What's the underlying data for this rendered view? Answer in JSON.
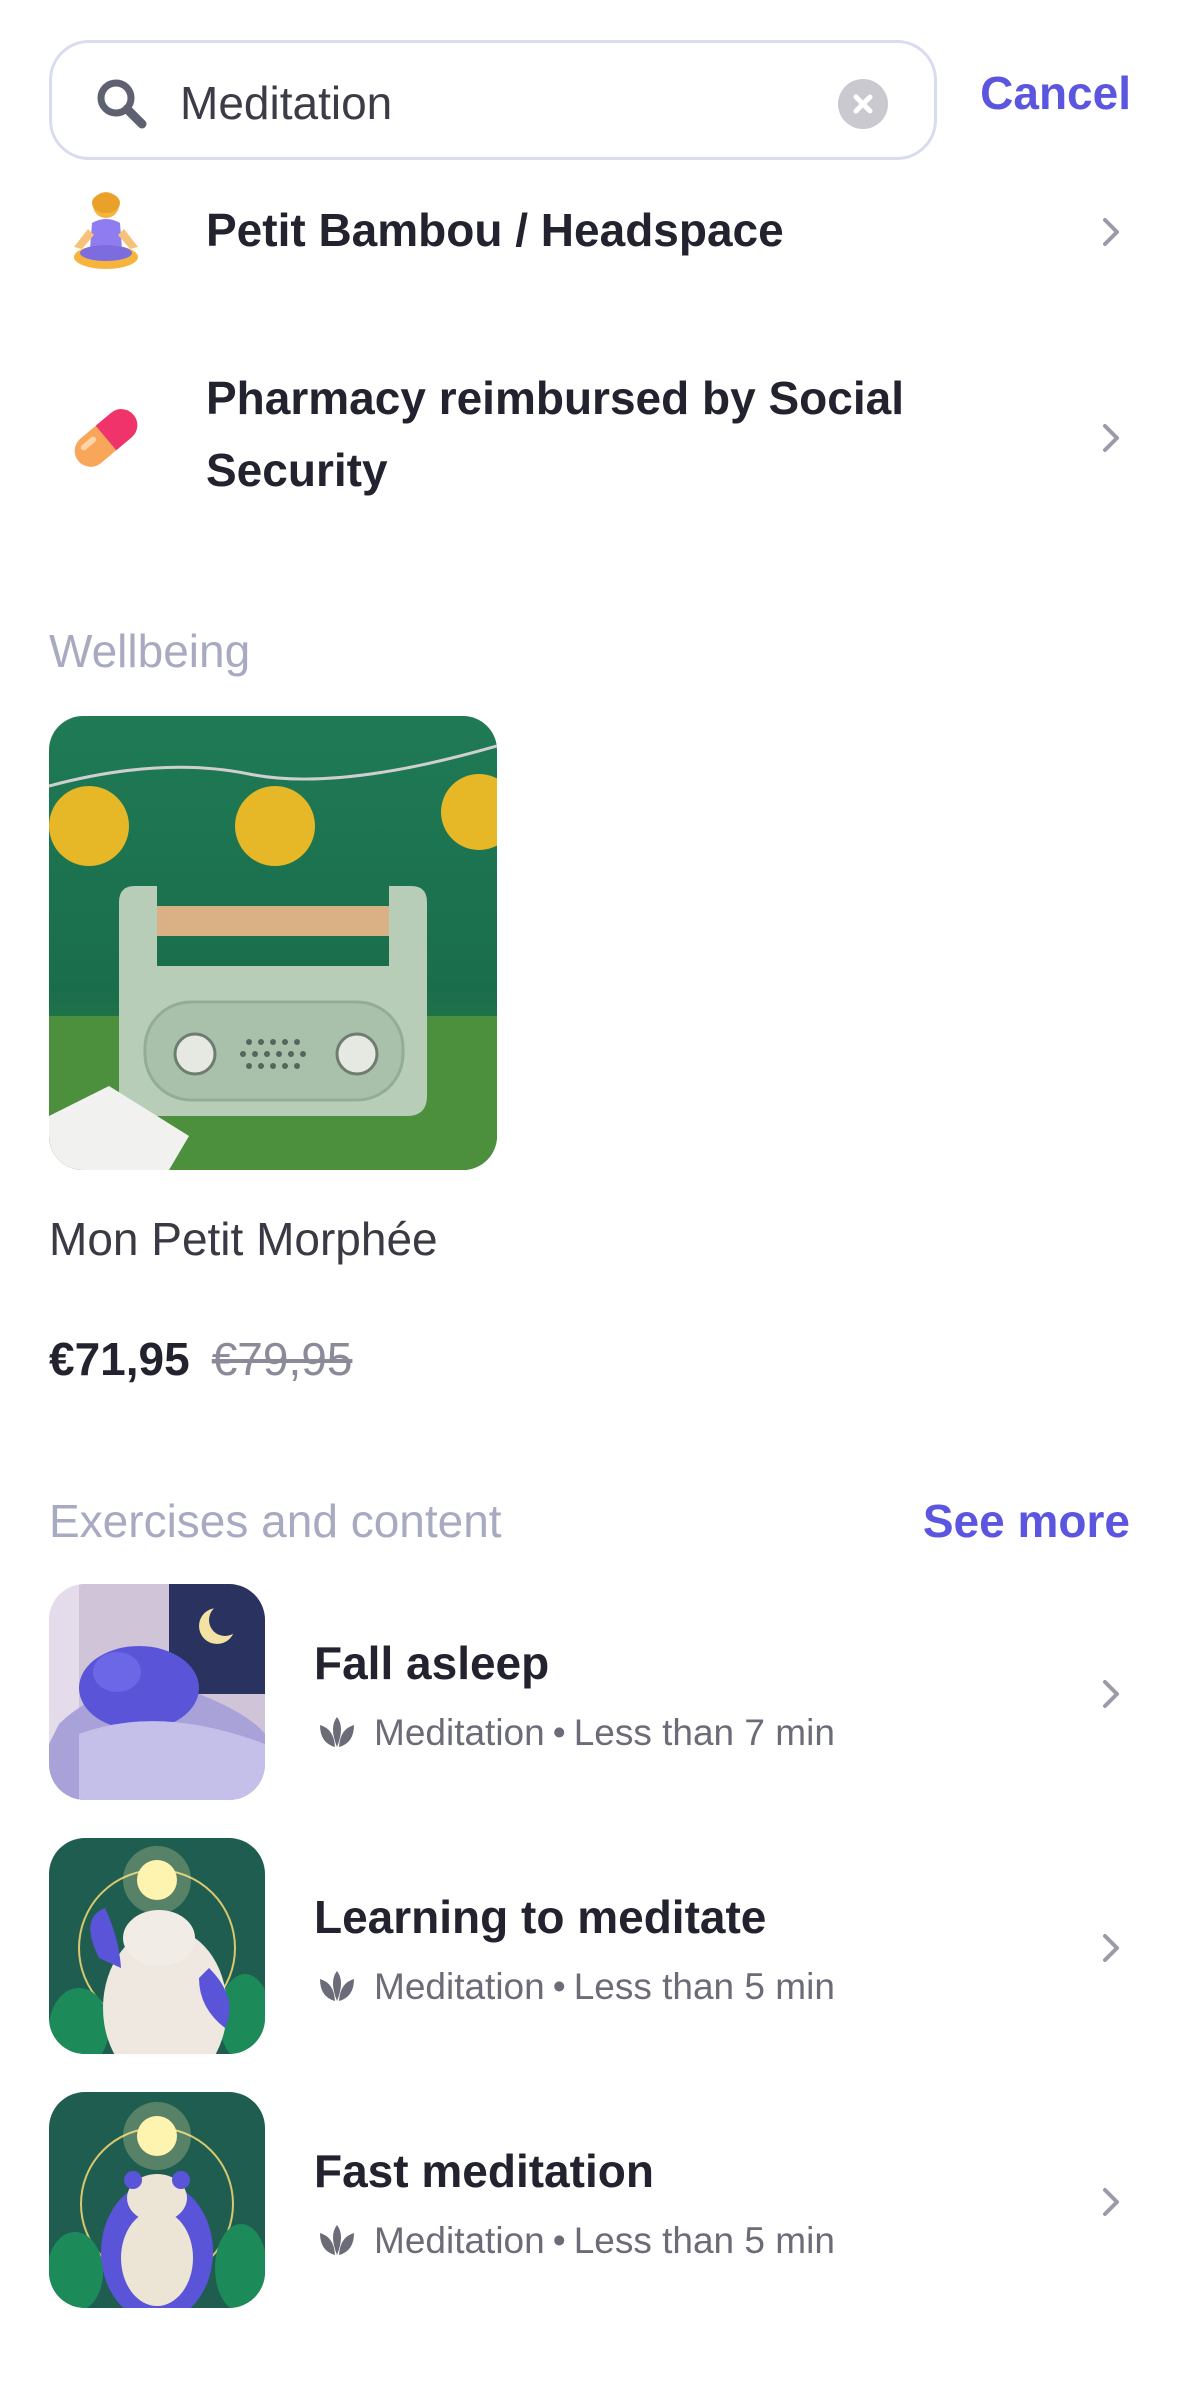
{
  "search": {
    "value": "Meditation",
    "cancel_label": "Cancel"
  },
  "results": [
    {
      "label": "Petit Bambou / Headspace",
      "icon": "meditating-person-icon"
    },
    {
      "label_line1": "Pharmacy reimbursed by Social",
      "label_line2": "Security",
      "icon": "pill-icon"
    }
  ],
  "wellbeing": {
    "title": "Wellbeing",
    "product": {
      "name": "Mon Petit Morphée",
      "price": "€71,95",
      "old_price": "€79,95"
    }
  },
  "exercises": {
    "title": "Exercises and content",
    "see_more_label": "See more",
    "items": [
      {
        "title": "Fall asleep",
        "category": "Meditation",
        "separator": "•",
        "duration": "Less than 7 min"
      },
      {
        "title": "Learning to meditate",
        "category": "Meditation",
        "separator": "•",
        "duration": "Less than 5 min"
      },
      {
        "title": "Fast meditation",
        "category": "Meditation",
        "separator": "•",
        "duration": "Less than 5 min"
      }
    ]
  },
  "colors": {
    "accent": "#5b55e0",
    "section_title": "#a8aac2",
    "text": "#23232f"
  }
}
